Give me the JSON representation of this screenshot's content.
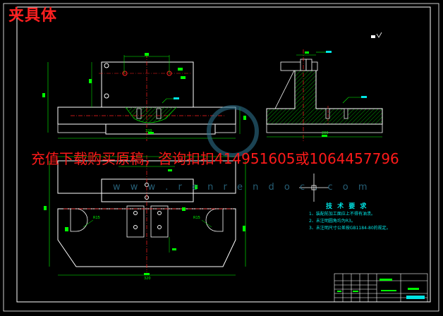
{
  "title": "夹具体",
  "banner": "充值下载购买原稿，咨询扣扣414951605或1064457796",
  "watermark": {
    "url": "w w w . r e n r e n d o c . c o m"
  },
  "technical_requirements": {
    "heading": "技 术 要 求",
    "items": [
      "1、装配前加工面应上不得有油渍。",
      "2、未注明圆角均为R3。",
      "3、未注明尺寸公差按GB1184-80的规定。"
    ]
  },
  "dimensions": {
    "top_view_width": "320",
    "side_view_width": "200",
    "bottom_view_width": "320",
    "radius_left": "R15",
    "radius_right": "R15"
  },
  "colors": {
    "background": "#000000",
    "frame": "#ffffff",
    "outline": "#ffffff",
    "dimension": "#00ff00",
    "centerline": "#ff2020",
    "hatch": "#00cc00",
    "annotation": "#00e5e5",
    "title": "#ff2020"
  }
}
